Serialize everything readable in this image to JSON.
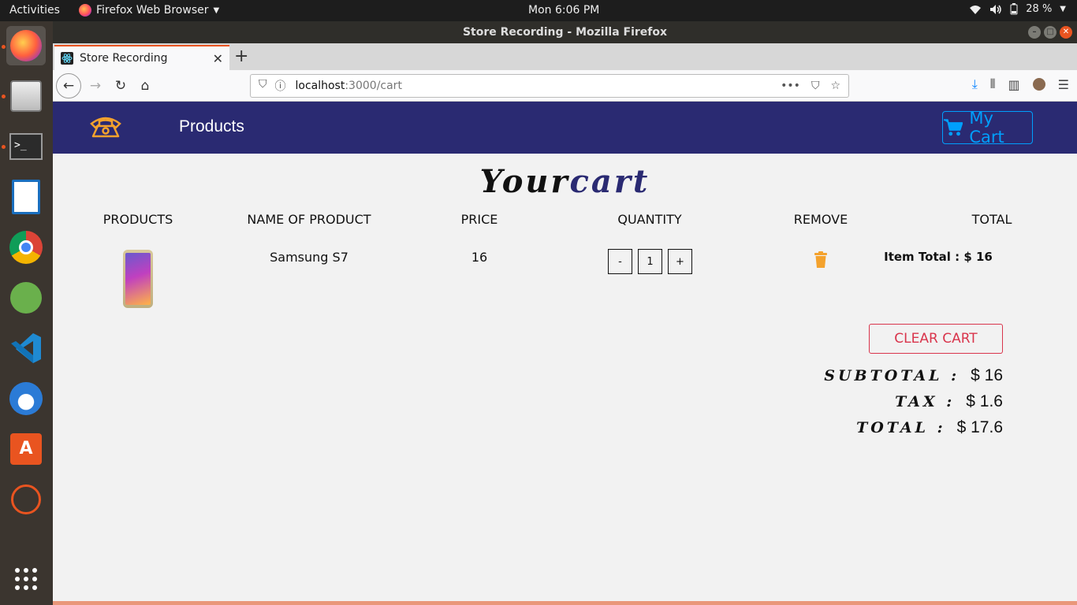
{
  "desktop": {
    "activities": "Activities",
    "app_menu": "Firefox Web Browser",
    "clock": "Mon  6:06 PM",
    "battery": "28 %"
  },
  "window": {
    "title": "Store Recording - Mozilla Firefox"
  },
  "browser": {
    "tab_title": "Store Recording",
    "url_host": "localhost",
    "url_path": ":3000/cart"
  },
  "store": {
    "nav": {
      "products_link": "Products",
      "cart_button": "My Cart"
    },
    "cart_title_part1": "Your",
    "cart_title_part2": "cart",
    "columns": [
      "products",
      "name of product",
      "price",
      "quantity",
      "remove",
      "total"
    ],
    "items": [
      {
        "name": "Samsung S7",
        "price": "16",
        "quantity": "1",
        "decrement_label": "-",
        "increment_label": "+",
        "item_total": "Item Total : $ 16"
      }
    ],
    "clear_cart": "clear cart",
    "summary": {
      "subtotal_label": "subtotal :",
      "subtotal_value": "$ 16",
      "tax_label": "tax :",
      "tax_value": "$ 1.6",
      "total_label": "total :",
      "total_value": "$ 17.6"
    }
  },
  "colors": {
    "nav_background": "#2a2a72",
    "cart_accent": "#009ffd",
    "danger": "#d9354c",
    "icon_orange": "#f4a22d"
  }
}
